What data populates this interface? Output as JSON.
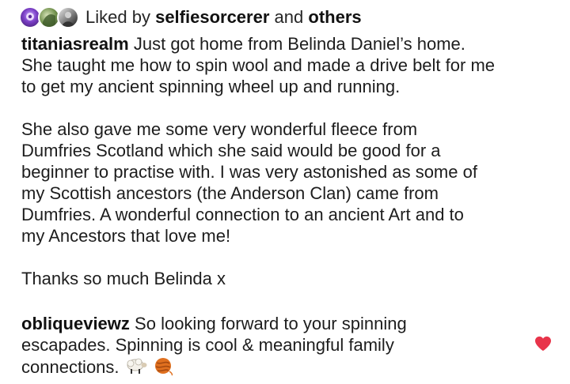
{
  "likes": {
    "prefix": "Liked by",
    "user": "selfiesorcerer",
    "joiner": "and",
    "others": "others"
  },
  "caption": {
    "username": "titaniasrealm",
    "first_line": "Just got home from Belinda Daniel’s home.",
    "paragraph1_rest": "She taught me how to spin wool and made a drive belt for me\nto get my ancient spinning wheel up and running.",
    "paragraph2": "She also gave me some very wonderful fleece from\nDumfries Scotland which she said would be good for a\nbeginner to practise with.  I was very astonished as some of\nmy Scottish ancestors (the Anderson Clan) came from\nDumfries.  A wonderful connection to an ancient Art and to\nmy Ancestors that love me!",
    "paragraph3": "Thanks so much Belinda x"
  },
  "comment": {
    "username": "obliqueviewz",
    "text": "So looking forward to your spinning\nescapades. Spinning is cool & meaningful family\nconnections.",
    "emojis": [
      "sheep-emoji",
      "yarn-emoji"
    ]
  },
  "icons": {
    "heart": "heart-icon",
    "heart_color": "#e8344a"
  }
}
